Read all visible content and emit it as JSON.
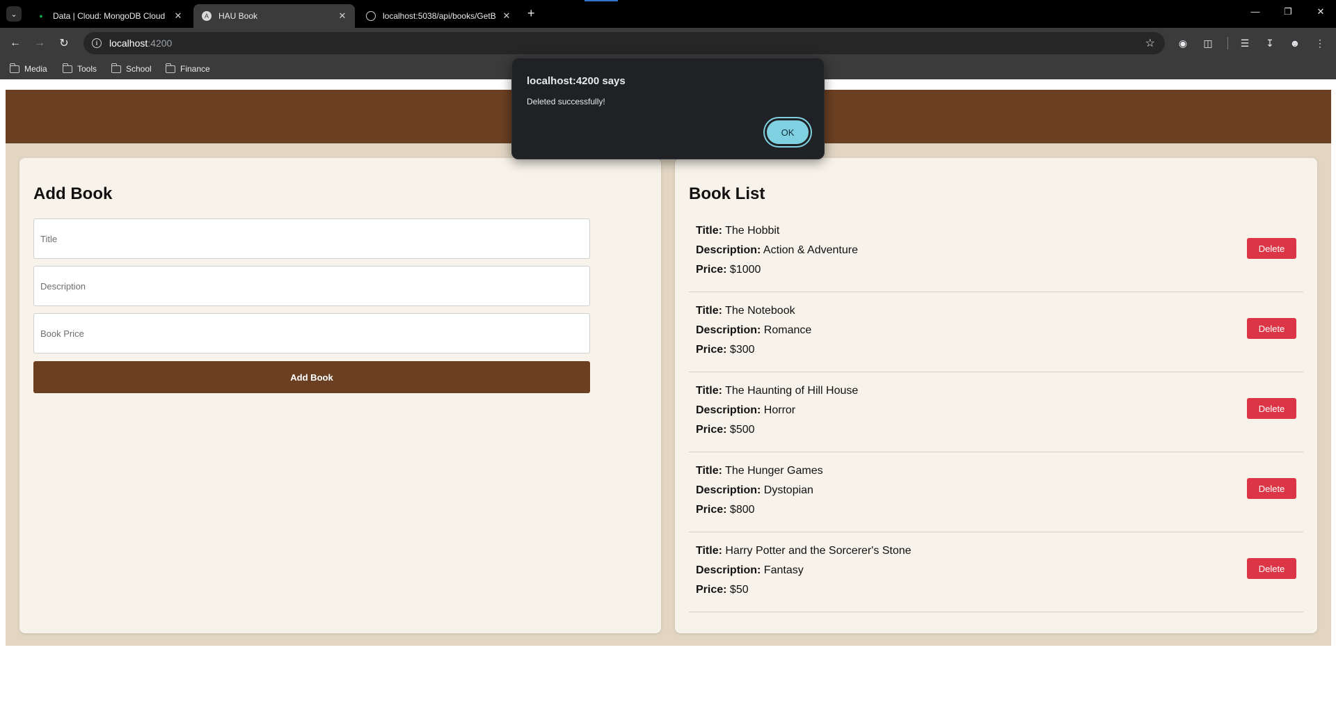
{
  "browser": {
    "tabs": [
      {
        "title": "Data | Cloud: MongoDB Cloud",
        "favicon": "mongodb-leaf-icon",
        "active": false
      },
      {
        "title": "HAU Book",
        "favicon": "angular-icon",
        "active": true
      },
      {
        "title": "localhost:5038/api/books/GetB",
        "favicon": "globe-icon",
        "active": false
      }
    ],
    "url_host": "localhost",
    "url_port": ":4200",
    "bookmarks": [
      "Media",
      "Tools",
      "School",
      "Finance"
    ]
  },
  "add_book": {
    "heading": "Add Book",
    "title_placeholder": "Title",
    "description_placeholder": "Description",
    "price_placeholder": "Book Price",
    "submit_label": "Add Book"
  },
  "book_list": {
    "heading": "Book List",
    "title_label": "Title:",
    "description_label": "Description:",
    "price_label": "Price:",
    "delete_label": "Delete",
    "books": [
      {
        "title": "The Hobbit",
        "description": "Action & Adventure",
        "price": "$1000"
      },
      {
        "title": "The Notebook",
        "description": "Romance",
        "price": "$300"
      },
      {
        "title": "The Haunting of Hill House",
        "description": "Horror",
        "price": "$500"
      },
      {
        "title": "The Hunger Games",
        "description": "Dystopian",
        "price": "$800"
      },
      {
        "title": "Harry Potter and the Sorcerer's Stone",
        "description": "Fantasy",
        "price": "$50"
      }
    ]
  },
  "alert": {
    "title": "localhost:4200 says",
    "message": "Deleted successfully!",
    "ok_label": "OK"
  },
  "colors": {
    "header_brown": "#6b3f22",
    "page_beige": "#e2d6c3",
    "panel_cream": "#f7f3ea",
    "delete_red": "#dc3545",
    "ok_cyan": "#7fd1e2"
  }
}
